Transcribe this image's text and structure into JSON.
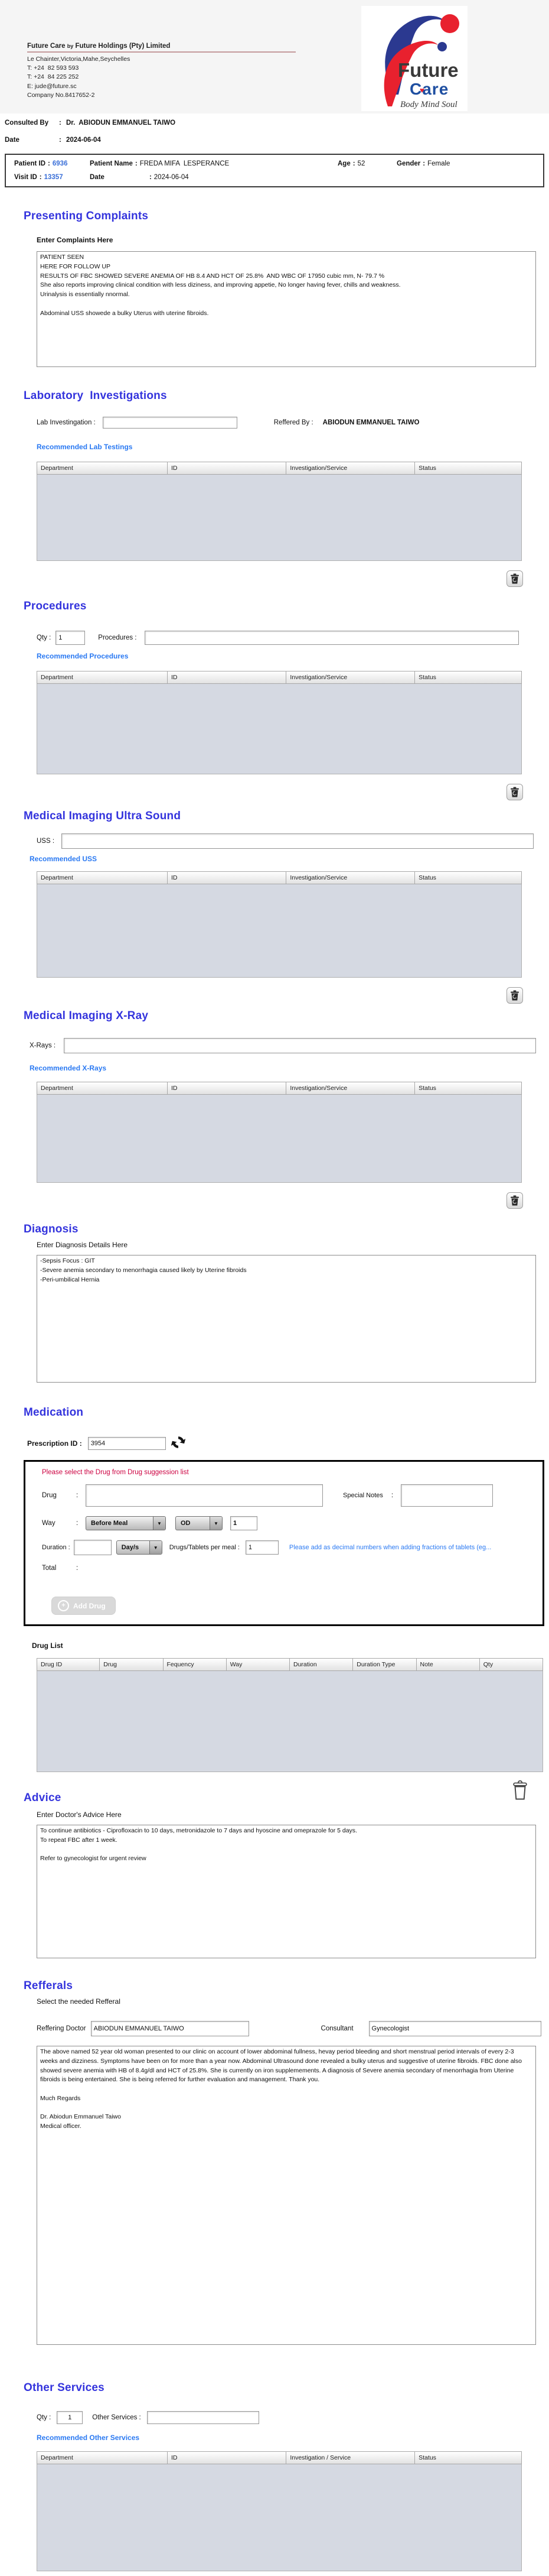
{
  "punct": {
    "colon": ":"
  },
  "colors": {
    "heading_blue": "#3434dd",
    "link_blue": "#2a79f2",
    "id_blue": "#3a6fd8",
    "hint_red": "#cc0040",
    "table_body_gray": "#d5d9e2",
    "logo_blue": "#2b3990",
    "logo_red": "#e8212e"
  },
  "icons": {
    "delete": "trash-icon",
    "refresh": "refresh-icon",
    "add": "plus-circle-icon",
    "dropdown": "chevron-down-icon",
    "heart": "heart-icon"
  },
  "header": {
    "company_pre": "Future Care ",
    "company_by": "by",
    "company_post": " Future Holdings (Pty) Limited",
    "address": "Le Chainter,Victoria,Mahe,Seychelles",
    "phone1": "T: +24  82 593 593",
    "phone2": "T: +24  84 225 252",
    "email": "E: jude@future.sc",
    "company_no": "Company No.8417652-2",
    "logo": {
      "word1": "Future",
      "word2": "Care",
      "tagline": "Body Mind Soul"
    }
  },
  "consult": {
    "consulted_by_label": "Consulted By",
    "consulted_by_value": "Dr.  ABIODUN EMMANUEL TAIWO",
    "date_label": "Date",
    "date_value": "2024-06-04"
  },
  "patient": {
    "patient_id_label": "Patient ID",
    "patient_id": "6936",
    "patient_name_label": "Patient Name",
    "patient_name": "FREDA MIFA  LESPERANCE",
    "age_label": "Age",
    "age": "52",
    "gender_label": "Gender",
    "gender": "Female",
    "visit_id_label": "Visit ID",
    "visit_id": "13357",
    "date_label": "Date",
    "date": "2024-06-04"
  },
  "complaints": {
    "title": "Presenting Complaints",
    "label": "Enter Complaints Here",
    "text": "PATIENT SEEN\nHERE FOR FOLLOW UP\nRESULTS OF FBC SHOWED SEVERE ANEMIA OF HB 8.4 AND HCT OF 25.8%  AND WBC OF 17950 cubic mm, N- 79.7 %\nShe also reports improving clinical condition with less diziness, and improving appetie, No longer having fever, chills and weakness.\nUrinalysis is essentially nnormal.\n\nAbdominal USS showede a bulky Uterus with uterine fibroids."
  },
  "lab": {
    "title": "Laboratory  Investigations",
    "input_label": "Lab Investingation :",
    "input_value": "",
    "referred_label": "Reffered By :",
    "referred_value": "ABIODUN EMMANUEL TAIWO",
    "recommended": "Recommended Lab Testings",
    "headers": [
      "Department",
      "ID",
      "Investigation/Service",
      "Status"
    ]
  },
  "procedures": {
    "title": "Procedures",
    "qty_label": "Qty :",
    "qty_value": "1",
    "input_label": "Procedures :",
    "input_value": "",
    "recommended": "Recommended Procedures",
    "headers": [
      "Department",
      "ID",
      "Investigation/Service",
      "Status"
    ]
  },
  "uss": {
    "title": "Medical Imaging Ultra Sound",
    "input_label": "USS :",
    "input_value": "",
    "recommended": "Recommended USS",
    "headers": [
      "Department",
      "ID",
      "Investigation/Service",
      "Status"
    ]
  },
  "xray": {
    "title": "Medical Imaging X-Ray",
    "input_label": "X-Rays :",
    "input_value": "",
    "recommended": "Recommended X-Rays",
    "headers": [
      "Department",
      "ID",
      "Investigation/Service",
      "Status"
    ]
  },
  "diagnosis": {
    "title": "Diagnosis",
    "label": "Enter Diagnosis Details Here",
    "text": "-Sepsis Focus : GIT\n-Severe anemia secondary to menorrhagia caused likely by Uterine fibroids\n-Peri-umbilical Hernia"
  },
  "medication": {
    "title": "Medication",
    "prescription_label": "Prescription ID :",
    "prescription_value": "3954",
    "hint_red": "Please select the Drug from Drug suggession list",
    "drug_label": "Drug",
    "drug_value": "",
    "special_notes_label": "Special Notes",
    "special_notes_value": "",
    "way_label": "Way",
    "way_meal": "Before Meal",
    "way_freq": "OD",
    "way_qty": "1",
    "duration_label": "Duration :",
    "duration_value": "",
    "duration_unit": "Day/s",
    "per_meal_label": "Drugs/Tablets per meal :",
    "per_meal_value": "1",
    "hint_blue": "Please add as decimal numbers when adding fractions of tablets (eg...",
    "total_label": "Total",
    "add_drug_label": "Add Drug",
    "drug_list_label": "Drug List",
    "drug_headers": [
      "Drug ID",
      "Drug",
      "Fequency",
      "Way",
      "Duration",
      "Duration Type",
      "Note",
      "Qty"
    ]
  },
  "advice": {
    "title": "Advice",
    "label": "Enter Doctor's Advice Here",
    "text": "To continue antibiotics - Ciprofloxacin to 10 days, metronidazole to 7 days and hyoscine and omeprazole for 5 days.\nTo repeat FBC after 1 week.\n\nRefer to gynecologist for urgent review"
  },
  "referrals": {
    "title": "Refferals",
    "subtitle": "Select the needed Refferal",
    "referring_label": "Reffering Doctor",
    "referring_value": "ABIODUN EMMANUEL TAIWO",
    "consultant_label": "Consultant",
    "consultant_value": "Gynecologist",
    "letter": "The above named 52 year old woman presented to our clinic on account of lower abdominal fullness, hevay period bleeding and short menstrual period intervals of every 2-3 weeks and dizziness. Symptoms have been on for more than a year now. Abdominal Ultrasound done revealed a bulky uterus and suggestive of uterine fibroids. FBC done also showed severe anemia with HB of 8.4g/dl and HCT of 25.8%. She is currently on iron supplemements. A diagnosis of Severe anemia secondary of menorrhagia from Uterine fibroids is being entertained. She is being referred for further evaluation and management. Thank you.\n\nMuch Regards\n\nDr. Abiodun Emmanuel Taiwo\nMedical officer."
  },
  "other": {
    "title": "Other Services",
    "qty_label": "Qty :",
    "qty_value": "1",
    "input_label": "Other Services :",
    "input_value": "",
    "recommended": "Recommended Other Services",
    "headers": [
      "Department",
      "ID",
      "Investigation / Service",
      "Status"
    ]
  }
}
